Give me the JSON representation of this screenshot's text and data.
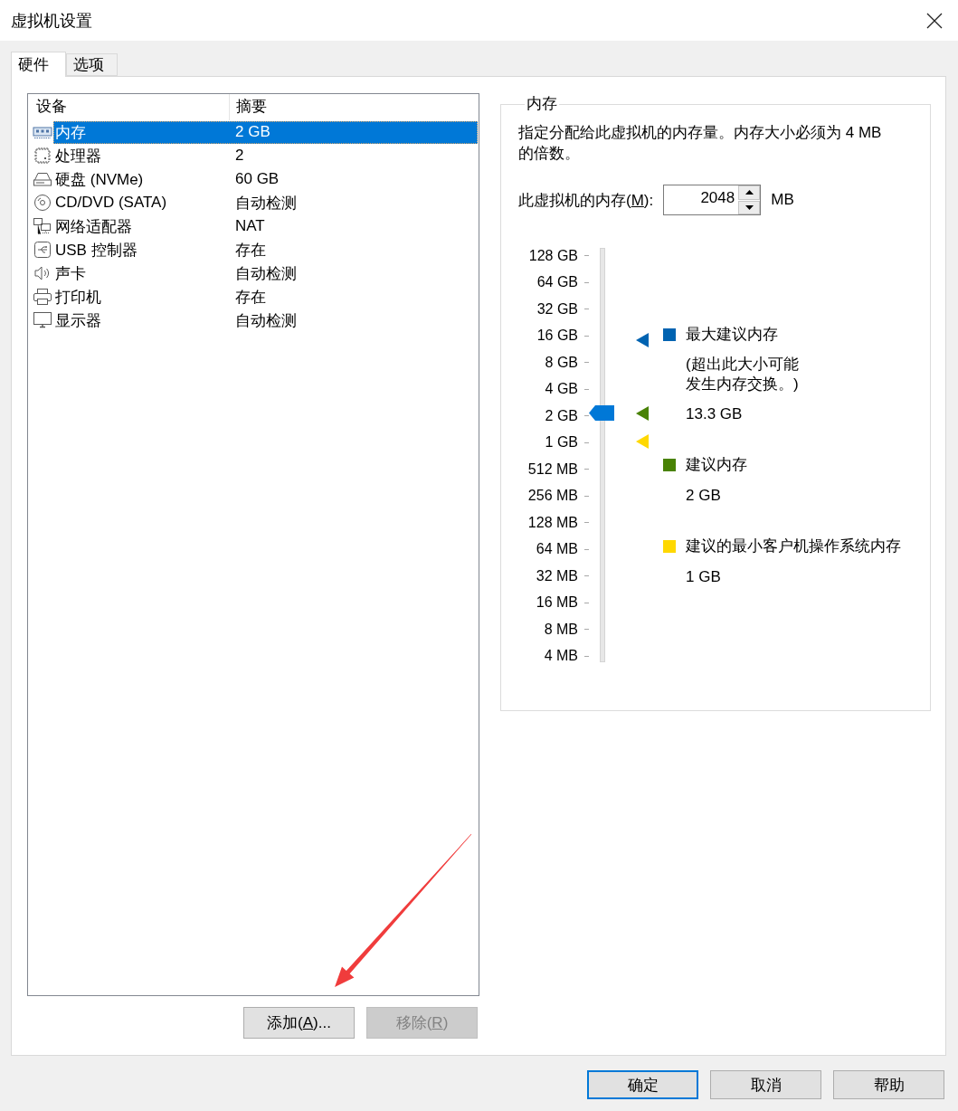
{
  "window": {
    "title": "虚拟机设置"
  },
  "tabs": [
    {
      "label": "硬件",
      "selected": true
    },
    {
      "label": "选项",
      "selected": false
    }
  ],
  "device_list": {
    "columns": [
      "设备",
      "摘要"
    ],
    "rows": [
      {
        "kind": "memory",
        "device": "内存",
        "summary": "2 GB",
        "selected": true
      },
      {
        "kind": "processor",
        "device": "处理器",
        "summary": "2",
        "selected": false
      },
      {
        "kind": "disk",
        "device": "硬盘 (NVMe)",
        "summary": "60 GB",
        "selected": false
      },
      {
        "kind": "cd",
        "device": "CD/DVD (SATA)",
        "summary": "自动检测",
        "selected": false
      },
      {
        "kind": "network",
        "device": "网络适配器",
        "summary": "NAT",
        "selected": false
      },
      {
        "kind": "usb",
        "device": "USB 控制器",
        "summary": "存在",
        "selected": false
      },
      {
        "kind": "sound",
        "device": "声卡",
        "summary": "自动检测",
        "selected": false
      },
      {
        "kind": "printer",
        "device": "打印机",
        "summary": "存在",
        "selected": false
      },
      {
        "kind": "display",
        "device": "显示器",
        "summary": "自动检测",
        "selected": false
      }
    ]
  },
  "list_buttons": [
    {
      "label": {
        "before": "添加(",
        "key": "A",
        "after": ")..."
      },
      "disabled": false
    },
    {
      "label": {
        "before": "移除(",
        "key": "R",
        "after": ")"
      },
      "disabled": true
    }
  ],
  "memory_panel": {
    "title": "内存",
    "description": "指定分配给此虚拟机的内存量。内存大小必须为 4 MB 的倍数。",
    "field": {
      "label": {
        "before": "此虚拟机的内存(",
        "key": "M",
        "after": "):"
      },
      "value": "2048",
      "unit": "MB"
    },
    "slider": {
      "ticks": [
        "128 GB",
        "64 GB",
        "32 GB",
        "16 GB",
        "8 GB",
        "4 GB",
        "2 GB",
        "1 GB",
        "512 MB",
        "256 MB",
        "128 MB",
        "64 MB",
        "32 MB",
        "16 MB",
        "8 MB",
        "4 MB"
      ],
      "level": 0.6,
      "markers": [
        {
          "color": "#0063b1",
          "level": 0.777
        },
        {
          "color": "#498205",
          "level": 0.6
        },
        {
          "color": "#ffd800",
          "level": 0.533
        }
      ]
    },
    "legend": [
      {
        "label": "最大建议内存",
        "note": "(超出此大小可能发生内存交换。)",
        "value": "13.3 GB",
        "color": "#0063b1"
      },
      {
        "label": "建议内存",
        "value": "2 GB",
        "color": "#498205"
      },
      {
        "label": "建议的最小客户机操作系统内存",
        "value": "1 GB",
        "color": "#ffd800"
      }
    ]
  },
  "dialog_buttons": [
    {
      "label": "确定",
      "default": true
    },
    {
      "label": "取消",
      "default": false
    },
    {
      "label": "帮助",
      "default": false
    }
  ]
}
